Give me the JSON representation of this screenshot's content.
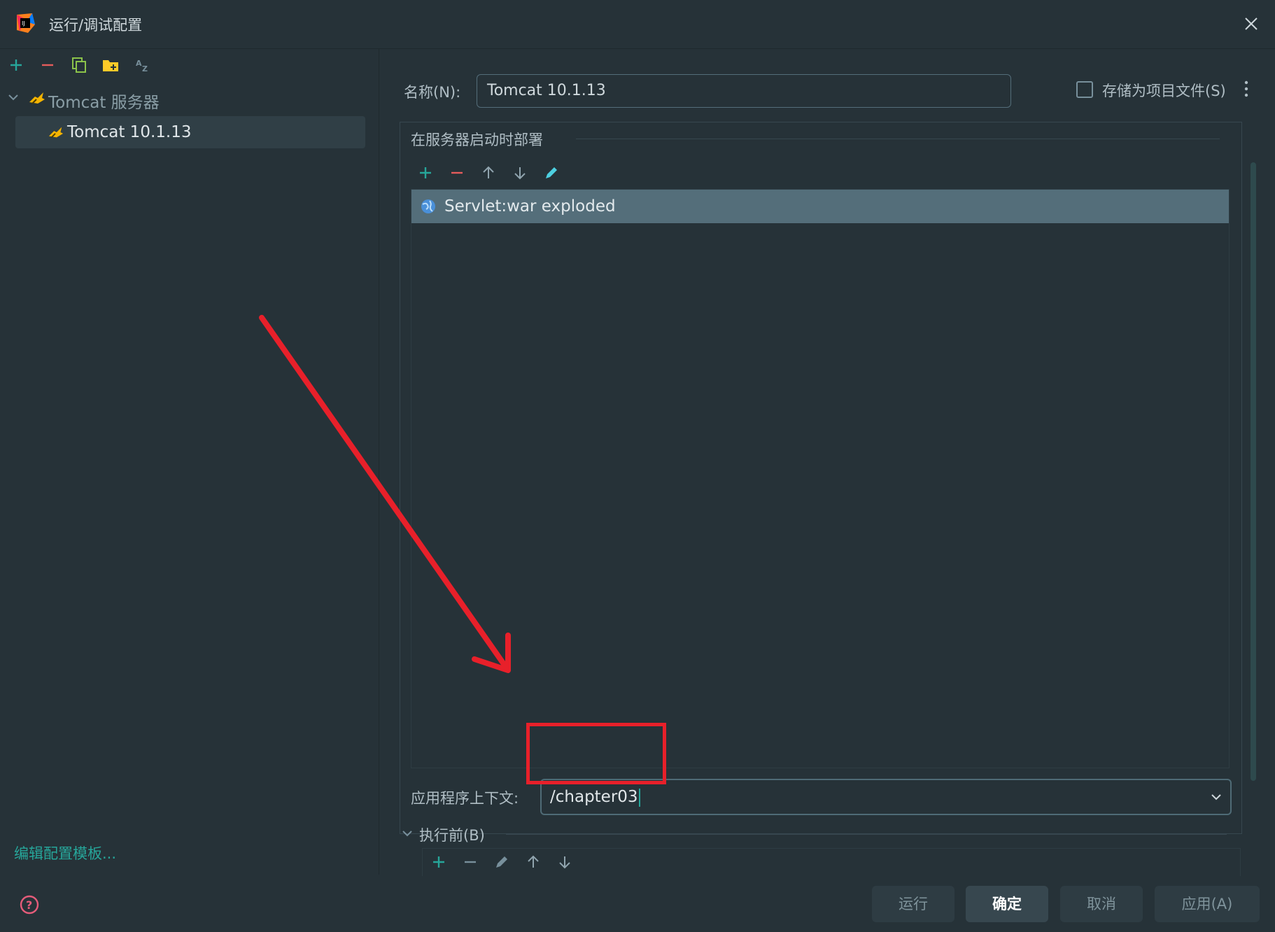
{
  "window": {
    "title": "运行/调试配置"
  },
  "left_panel": {
    "group_label": "Tomcat 服务器",
    "selected_item": "Tomcat 10.1.13",
    "edit_templates_link": "编辑配置模板..."
  },
  "config": {
    "name_label": "名称(N):",
    "name_value": "Tomcat 10.1.13",
    "store_as_project_file_label": "存储为项目文件(S)",
    "store_as_project_file_checked": false
  },
  "deployment": {
    "section_title": "在服务器启动时部署",
    "artifacts": [
      "Servlet:war exploded"
    ],
    "context_label": "应用程序上下文:",
    "context_value": "/chapter03"
  },
  "before_launch": {
    "label": "执行前(B)"
  },
  "buttons": {
    "run": "运行",
    "ok": "确定",
    "cancel": "取消",
    "apply": "应用(A)"
  },
  "colors": {
    "background": "#263238",
    "accent_teal": "#26a69a",
    "selection_row": "#546e7a",
    "annotation_red": "#e8202a",
    "remove_red": "#e55c5c"
  }
}
